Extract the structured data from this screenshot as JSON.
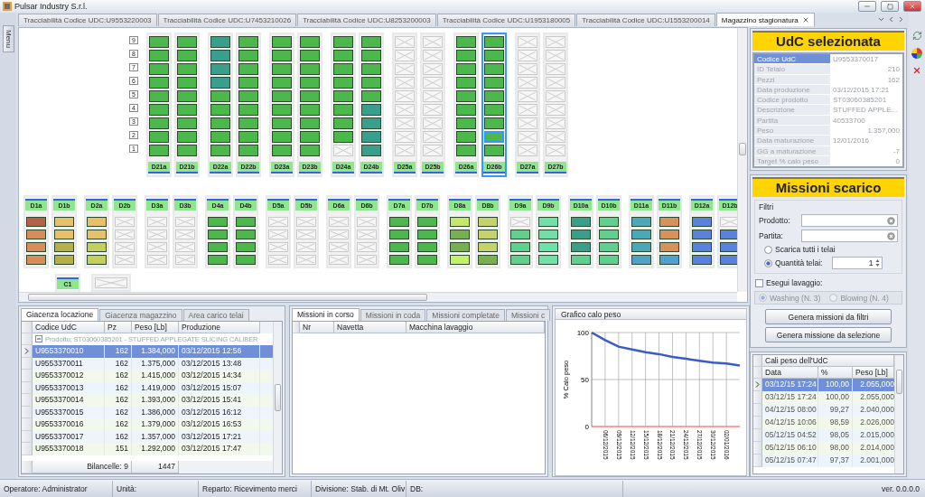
{
  "window": {
    "title": "Pulsar Industry S.r.l."
  },
  "menu_tab": {
    "label": "Menu"
  },
  "tabs": [
    {
      "label": "Tracciabilità Codice UDC:U9553220003",
      "selected": false
    },
    {
      "label": "Tracciabilità Codice UDC:U7453210026",
      "selected": false
    },
    {
      "label": "Tracciabilità Codice UDC:U8253200003",
      "selected": false
    },
    {
      "label": "Tracciabilità Codice UDC:U1953180005",
      "selected": false
    },
    {
      "label": "Tracciabilità Codice UDC:U1553200014",
      "selected": false
    },
    {
      "label": "Magazzino stagionatura",
      "selected": true
    }
  ],
  "warehouse": {
    "row_labels": [
      "9",
      "8",
      "7",
      "6",
      "5",
      "4",
      "3",
      "2",
      "1"
    ],
    "upper_columns": [
      {
        "label": "D21a",
        "selected": false,
        "slots": [
          {
            "kind": "filled",
            "color": "#4cb84c",
            "selected": false
          },
          {
            "kind": "filled",
            "color": "#4cb84c",
            "selected": false
          },
          {
            "kind": "filled",
            "color": "#4cb84c",
            "selected": false
          },
          {
            "kind": "filled",
            "color": "#4cb84c",
            "selected": false
          },
          {
            "kind": "filled",
            "color": "#4cb84c",
            "selected": false
          },
          {
            "kind": "filled",
            "color": "#4cb84c",
            "selected": false
          },
          {
            "kind": "filled",
            "color": "#4cb84c",
            "selected": false
          },
          {
            "kind": "filled",
            "color": "#4cb84c",
            "selected": false
          },
          {
            "kind": "filled",
            "color": "#4cb84c",
            "selected": false
          }
        ]
      },
      {
        "label": "D21b",
        "selected": false,
        "slots": [
          {
            "kind": "filled",
            "color": "#4cb84c",
            "selected": false
          },
          {
            "kind": "filled",
            "color": "#4cb84c",
            "selected": false
          },
          {
            "kind": "filled",
            "color": "#4cb84c",
            "selected": false
          },
          {
            "kind": "filled",
            "color": "#4cb84c",
            "selected": false
          },
          {
            "kind": "filled",
            "color": "#4cb84c",
            "selected": false
          },
          {
            "kind": "filled",
            "color": "#4cb84c",
            "selected": false
          },
          {
            "kind": "filled",
            "color": "#4cb84c",
            "selected": false
          },
          {
            "kind": "filled",
            "color": "#4cb84c",
            "selected": false
          },
          {
            "kind": "filled",
            "color": "#4cb84c",
            "selected": false
          }
        ]
      },
      {
        "label": "D22a",
        "selected": false,
        "slots": [
          {
            "kind": "filled",
            "color": "#3a9e8c",
            "selected": false
          },
          {
            "kind": "filled",
            "color": "#3a9e8c",
            "selected": false
          },
          {
            "kind": "filled",
            "color": "#3a9e8c",
            "selected": false
          },
          {
            "kind": "filled",
            "color": "#3a9e8c",
            "selected": false
          },
          {
            "kind": "filled",
            "color": "#4cb84c",
            "selected": false
          },
          {
            "kind": "filled",
            "color": "#4cb84c",
            "selected": false
          },
          {
            "kind": "filled",
            "color": "#4cb84c",
            "selected": false
          },
          {
            "kind": "filled",
            "color": "#4cb84c",
            "selected": false
          },
          {
            "kind": "filled",
            "color": "#4cb84c",
            "selected": false
          }
        ]
      },
      {
        "label": "D22b",
        "selected": false,
        "slots": [
          {
            "kind": "filled",
            "color": "#4cb84c",
            "selected": false
          },
          {
            "kind": "filled",
            "color": "#4cb84c",
            "selected": false
          },
          {
            "kind": "filled",
            "color": "#4cb84c",
            "selected": false
          },
          {
            "kind": "filled",
            "color": "#4cb84c",
            "selected": false
          },
          {
            "kind": "filled",
            "color": "#4cb84c",
            "selected": false
          },
          {
            "kind": "filled",
            "color": "#4cb84c",
            "selected": false
          },
          {
            "kind": "filled",
            "color": "#4cb84c",
            "selected": false
          },
          {
            "kind": "filled",
            "color": "#4cb84c",
            "selected": false
          },
          {
            "kind": "filled",
            "color": "#4cb84c",
            "selected": false
          }
        ]
      },
      {
        "label": "D23a",
        "selected": false,
        "slots": [
          {
            "kind": "filled",
            "color": "#4cb84c",
            "selected": false
          },
          {
            "kind": "filled",
            "color": "#4cb84c",
            "selected": false
          },
          {
            "kind": "filled",
            "color": "#4cb84c",
            "selected": false
          },
          {
            "kind": "filled",
            "color": "#4cb84c",
            "selected": false
          },
          {
            "kind": "filled",
            "color": "#4cb84c",
            "selected": false
          },
          {
            "kind": "filled",
            "color": "#4cb84c",
            "selected": false
          },
          {
            "kind": "filled",
            "color": "#4cb84c",
            "selected": false
          },
          {
            "kind": "filled",
            "color": "#4cb84c",
            "selected": false
          },
          {
            "kind": "filled",
            "color": "#4cb84c",
            "selected": false
          }
        ]
      },
      {
        "label": "D23b",
        "selected": false,
        "slots": [
          {
            "kind": "filled",
            "color": "#4cb84c",
            "selected": false
          },
          {
            "kind": "filled",
            "color": "#4cb84c",
            "selected": false
          },
          {
            "kind": "filled",
            "color": "#4cb84c",
            "selected": false
          },
          {
            "kind": "filled",
            "color": "#4cb84c",
            "selected": false
          },
          {
            "kind": "filled",
            "color": "#4cb84c",
            "selected": false
          },
          {
            "kind": "filled",
            "color": "#4cb84c",
            "selected": false
          },
          {
            "kind": "filled",
            "color": "#4cb84c",
            "selected": false
          },
          {
            "kind": "filled",
            "color": "#4cb84c",
            "selected": false
          },
          {
            "kind": "filled",
            "color": "#4cb84c",
            "selected": false
          }
        ]
      },
      {
        "label": "D24a",
        "selected": false,
        "slots": [
          {
            "kind": "filled",
            "color": "#4cb84c",
            "selected": false
          },
          {
            "kind": "filled",
            "color": "#4cb84c",
            "selected": false
          },
          {
            "kind": "filled",
            "color": "#4cb84c",
            "selected": false
          },
          {
            "kind": "filled",
            "color": "#4cb84c",
            "selected": false
          },
          {
            "kind": "filled",
            "color": "#4cb84c",
            "selected": false
          },
          {
            "kind": "filled",
            "color": "#4cb84c",
            "selected": false
          },
          {
            "kind": "filled",
            "color": "#4cb84c",
            "selected": false
          },
          {
            "kind": "filled",
            "color": "#4cb84c",
            "selected": false
          },
          {
            "kind": "empty",
            "selected": false
          }
        ]
      },
      {
        "label": "D24b",
        "selected": false,
        "slots": [
          {
            "kind": "filled",
            "color": "#4cb84c",
            "selected": false
          },
          {
            "kind": "filled",
            "color": "#4cb84c",
            "selected": false
          },
          {
            "kind": "filled",
            "color": "#4cb84c",
            "selected": false
          },
          {
            "kind": "filled",
            "color": "#4cb84c",
            "selected": false
          },
          {
            "kind": "filled",
            "color": "#4cb84c",
            "selected": false
          },
          {
            "kind": "filled",
            "color": "#3a9e8c",
            "selected": false
          },
          {
            "kind": "filled",
            "color": "#3a9e8c",
            "selected": false
          },
          {
            "kind": "filled",
            "color": "#3a9e8c",
            "selected": false
          },
          {
            "kind": "filled",
            "color": "#3a9e8c",
            "selected": false
          }
        ]
      },
      {
        "label": "D25a",
        "selected": false,
        "slots": [
          {
            "kind": "empty",
            "selected": false
          },
          {
            "kind": "empty",
            "selected": false
          },
          {
            "kind": "empty",
            "selected": false
          },
          {
            "kind": "empty",
            "selected": false
          },
          {
            "kind": "empty",
            "selected": false
          },
          {
            "kind": "empty",
            "selected": false
          },
          {
            "kind": "empty",
            "selected": false
          },
          {
            "kind": "empty",
            "selected": false
          },
          {
            "kind": "empty",
            "selected": false
          }
        ]
      },
      {
        "label": "D25b",
        "selected": false,
        "slots": [
          {
            "kind": "empty",
            "selected": false
          },
          {
            "kind": "empty",
            "selected": false
          },
          {
            "kind": "empty",
            "selected": false
          },
          {
            "kind": "empty",
            "selected": false
          },
          {
            "kind": "empty",
            "selected": false
          },
          {
            "kind": "empty",
            "selected": false
          },
          {
            "kind": "empty",
            "selected": false
          },
          {
            "kind": "empty",
            "selected": false
          },
          {
            "kind": "empty",
            "selected": false
          }
        ]
      },
      {
        "label": "D26a",
        "selected": false,
        "slots": [
          {
            "kind": "filled",
            "color": "#4cb84c",
            "selected": false
          },
          {
            "kind": "filled",
            "color": "#4cb84c",
            "selected": false
          },
          {
            "kind": "filled",
            "color": "#4cb84c",
            "selected": false
          },
          {
            "kind": "filled",
            "color": "#4cb84c",
            "selected": false
          },
          {
            "kind": "filled",
            "color": "#4cb84c",
            "selected": false
          },
          {
            "kind": "filled",
            "color": "#4cb84c",
            "selected": false
          },
          {
            "kind": "filled",
            "color": "#4cb84c",
            "selected": false
          },
          {
            "kind": "filled",
            "color": "#4cb84c",
            "selected": false
          },
          {
            "kind": "filled",
            "color": "#4cb84c",
            "selected": false
          }
        ]
      },
      {
        "label": "D26b",
        "selected": true,
        "slots": [
          {
            "kind": "filled",
            "color": "#4cb84c",
            "selected": false
          },
          {
            "kind": "filled",
            "color": "#4cb84c",
            "selected": false
          },
          {
            "kind": "filled",
            "color": "#4cb84c",
            "selected": false
          },
          {
            "kind": "filled",
            "color": "#4cb84c",
            "selected": false
          },
          {
            "kind": "filled",
            "color": "#4cb84c",
            "selected": false
          },
          {
            "kind": "filled",
            "color": "#4cb84c",
            "selected": false
          },
          {
            "kind": "filled",
            "color": "#4cb84c",
            "selected": false
          },
          {
            "kind": "filled",
            "color": "#4cb84c",
            "selected": true
          },
          {
            "kind": "filled",
            "color": "#4cb84c",
            "selected": false
          }
        ]
      },
      {
        "label": "D27a",
        "selected": false,
        "slots": [
          {
            "kind": "empty",
            "selected": false
          },
          {
            "kind": "empty",
            "selected": false
          },
          {
            "kind": "empty",
            "selected": false
          },
          {
            "kind": "empty",
            "selected": false
          },
          {
            "kind": "empty",
            "selected": false
          },
          {
            "kind": "empty",
            "selected": false
          },
          {
            "kind": "empty",
            "selected": false
          },
          {
            "kind": "empty",
            "selected": false
          },
          {
            "kind": "empty",
            "selected": false
          }
        ]
      },
      {
        "label": "D27b",
        "selected": false,
        "slots": [
          {
            "kind": "empty",
            "selected": false
          },
          {
            "kind": "empty",
            "selected": false
          },
          {
            "kind": "empty",
            "selected": false
          },
          {
            "kind": "empty",
            "selected": false
          },
          {
            "kind": "empty",
            "selected": false
          },
          {
            "kind": "empty",
            "selected": false
          },
          {
            "kind": "empty",
            "selected": false
          },
          {
            "kind": "empty",
            "selected": false
          },
          {
            "kind": "empty",
            "selected": false
          }
        ]
      }
    ],
    "lower_columns": [
      {
        "label": "D1a",
        "slots": [
          {
            "kind": "filled",
            "color": "#b5614a"
          },
          {
            "kind": "filled",
            "color": "#d98b5a"
          },
          {
            "kind": "filled",
            "color": "#d98b5a"
          },
          {
            "kind": "filled",
            "color": "#d98b5a"
          }
        ]
      },
      {
        "label": "D1b",
        "slots": [
          {
            "kind": "filled",
            "color": "#e8c06a"
          },
          {
            "kind": "filled",
            "color": "#e8c06a"
          },
          {
            "kind": "filled",
            "color": "#b8ae4a"
          },
          {
            "kind": "filled",
            "color": "#b8ae4a"
          }
        ]
      },
      {
        "label": "D2a",
        "slots": [
          {
            "kind": "filled",
            "color": "#e8c06a"
          },
          {
            "kind": "filled",
            "color": "#e8c06a"
          },
          {
            "kind": "filled",
            "color": "#c4cf5e"
          },
          {
            "kind": "filled",
            "color": "#c4cf5e"
          }
        ]
      },
      {
        "label": "D2b",
        "slots": [
          {
            "kind": "empty"
          },
          {
            "kind": "empty"
          },
          {
            "kind": "empty"
          },
          {
            "kind": "empty"
          }
        ]
      },
      {
        "label": "D3a",
        "slots": [
          {
            "kind": "empty"
          },
          {
            "kind": "empty"
          },
          {
            "kind": "empty"
          },
          {
            "kind": "empty"
          }
        ]
      },
      {
        "label": "D3b",
        "slots": [
          {
            "kind": "empty"
          },
          {
            "kind": "empty"
          },
          {
            "kind": "empty"
          },
          {
            "kind": "empty"
          }
        ]
      },
      {
        "label": "D4a",
        "slots": [
          {
            "kind": "filled",
            "color": "#4cb84c"
          },
          {
            "kind": "filled",
            "color": "#4cb84c"
          },
          {
            "kind": "filled",
            "color": "#4cb84c"
          },
          {
            "kind": "filled",
            "color": "#4cb84c"
          }
        ]
      },
      {
        "label": "D4b",
        "slots": [
          {
            "kind": "filled",
            "color": "#4cb84c"
          },
          {
            "kind": "filled",
            "color": "#4cb84c"
          },
          {
            "kind": "filled",
            "color": "#4cb84c"
          },
          {
            "kind": "filled",
            "color": "#4cb84c"
          }
        ]
      },
      {
        "label": "D5a",
        "slots": [
          {
            "kind": "empty"
          },
          {
            "kind": "empty"
          },
          {
            "kind": "empty"
          },
          {
            "kind": "empty"
          }
        ]
      },
      {
        "label": "D5b",
        "slots": [
          {
            "kind": "empty"
          },
          {
            "kind": "empty"
          },
          {
            "kind": "empty"
          },
          {
            "kind": "empty"
          }
        ]
      },
      {
        "label": "D6a",
        "slots": [
          {
            "kind": "empty"
          },
          {
            "kind": "empty"
          },
          {
            "kind": "empty"
          },
          {
            "kind": "empty"
          }
        ]
      },
      {
        "label": "D6b",
        "slots": [
          {
            "kind": "empty"
          },
          {
            "kind": "empty"
          },
          {
            "kind": "empty"
          },
          {
            "kind": "empty"
          }
        ]
      },
      {
        "label": "D7a",
        "slots": [
          {
            "kind": "filled",
            "color": "#4cb84c"
          },
          {
            "kind": "filled",
            "color": "#4cb84c"
          },
          {
            "kind": "filled",
            "color": "#4cb84c"
          },
          {
            "kind": "filled",
            "color": "#4cb84c"
          }
        ]
      },
      {
        "label": "D7b",
        "slots": [
          {
            "kind": "filled",
            "color": "#4cb84c"
          },
          {
            "kind": "filled",
            "color": "#4cb84c"
          },
          {
            "kind": "filled",
            "color": "#4cb84c"
          },
          {
            "kind": "filled",
            "color": "#4cb84c"
          }
        ]
      },
      {
        "label": "D8a",
        "slots": [
          {
            "kind": "filled",
            "color": "#c5e86a"
          },
          {
            "kind": "filled",
            "color": "#78b050"
          },
          {
            "kind": "filled",
            "color": "#78b050"
          },
          {
            "kind": "filled",
            "color": "#c5f06a"
          }
        ]
      },
      {
        "label": "D8b",
        "slots": [
          {
            "kind": "filled",
            "color": "#c8d26a"
          },
          {
            "kind": "filled",
            "color": "#c8d26a"
          },
          {
            "kind": "filled",
            "color": "#c8d26a"
          },
          {
            "kind": "filled",
            "color": "#78b050"
          }
        ]
      },
      {
        "label": "D9a",
        "slots": [
          {
            "kind": "empty"
          },
          {
            "kind": "filled",
            "color": "#5fd090"
          },
          {
            "kind": "filled",
            "color": "#5fd090"
          },
          {
            "kind": "filled",
            "color": "#5fd090"
          }
        ]
      },
      {
        "label": "D9b",
        "slots": [
          {
            "kind": "filled",
            "color": "#6ee0a8"
          },
          {
            "kind": "filled",
            "color": "#6ee0a8"
          },
          {
            "kind": "filled",
            "color": "#6ee0a8"
          },
          {
            "kind": "filled",
            "color": "#6ee0a8"
          }
        ]
      },
      {
        "label": "D10a",
        "slots": [
          {
            "kind": "filled",
            "color": "#3a9e8c"
          },
          {
            "kind": "filled",
            "color": "#3a9e8c"
          },
          {
            "kind": "filled",
            "color": "#3a9e8c"
          },
          {
            "kind": "filled",
            "color": "#5fd090"
          }
        ]
      },
      {
        "label": "D10b",
        "slots": [
          {
            "kind": "filled",
            "color": "#5fd090"
          },
          {
            "kind": "filled",
            "color": "#5fd090"
          },
          {
            "kind": "filled",
            "color": "#5fd090"
          },
          {
            "kind": "filled",
            "color": "#5fd090"
          }
        ]
      },
      {
        "label": "D11a",
        "slots": [
          {
            "kind": "filled",
            "color": "#4aa8b8"
          },
          {
            "kind": "filled",
            "color": "#4aa8b8"
          },
          {
            "kind": "filled",
            "color": "#4aa8b8"
          },
          {
            "kind": "filled",
            "color": "#50a0c8"
          }
        ]
      },
      {
        "label": "D11b",
        "slots": [
          {
            "kind": "filled",
            "color": "#d9905a"
          },
          {
            "kind": "filled",
            "color": "#d9905a"
          },
          {
            "kind": "filled",
            "color": "#d9905a"
          },
          {
            "kind": "filled",
            "color": "#50a0d0"
          }
        ]
      },
      {
        "label": "D12a",
        "slots": [
          {
            "kind": "filled",
            "color": "#5a80e0"
          },
          {
            "kind": "filled",
            "color": "#5a80e0"
          },
          {
            "kind": "filled",
            "color": "#5a80e0"
          },
          {
            "kind": "filled",
            "color": "#5a80e0"
          }
        ]
      },
      {
        "label": "D12b",
        "slots": [
          {
            "kind": "empty"
          },
          {
            "kind": "filled",
            "color": "#5a80e0"
          },
          {
            "kind": "filled",
            "color": "#5a80e0"
          },
          {
            "kind": "filled",
            "color": "#5a80e0"
          }
        ]
      }
    ],
    "c_bay": {
      "label": "C1",
      "slots": [
        {
          "kind": "empty"
        }
      ]
    }
  },
  "stock_panel": {
    "tabs": [
      {
        "label": "Giacenza locazione",
        "selected": true
      },
      {
        "label": "Giacenza magazzino",
        "selected": false
      },
      {
        "label": "Area carico telai",
        "selected": false
      }
    ],
    "columns": [
      "Codice UdC",
      "Pz",
      "Peso [Lb]",
      "Produzione"
    ],
    "group_label": "Prodotto: ST03060385201  - STUFFED APPLEGATE SLICING CALIBER",
    "rows": [
      {
        "code": "U9553370010",
        "pz": "162",
        "peso": "1.384,000",
        "produzione": "03/12/2015 12:56",
        "selected": true
      },
      {
        "code": "U9553370011",
        "pz": "162",
        "peso": "1.375,000",
        "produzione": "03/12/2015 13:48",
        "selected": false
      },
      {
        "code": "U9553370012",
        "pz": "162",
        "peso": "1.415,000",
        "produzione": "03/12/2015 14:34",
        "selected": false
      },
      {
        "code": "U9553370013",
        "pz": "162",
        "peso": "1.419,000",
        "produzione": "03/12/2015 15:07",
        "selected": false
      },
      {
        "code": "U9553370014",
        "pz": "162",
        "peso": "1.393,000",
        "produzione": "03/12/2015 15:41",
        "selected": false
      },
      {
        "code": "U9553370015",
        "pz": "162",
        "peso": "1.386,000",
        "produzione": "03/12/2015 16:12",
        "selected": false
      },
      {
        "code": "U9553370016",
        "pz": "162",
        "peso": "1.379,000",
        "produzione": "03/12/2015 16:53",
        "selected": false
      },
      {
        "code": "U9553370017",
        "pz": "162",
        "peso": "1.357,000",
        "produzione": "03/12/2015 17:21",
        "selected": false
      },
      {
        "code": "U9553370018",
        "pz": "151",
        "peso": "1.292,000",
        "produzione": "03/12/2015 17:47",
        "selected": false
      }
    ],
    "footer": {
      "count": "Bilancelle: 9",
      "total": "1447"
    }
  },
  "missions_panel": {
    "tabs": [
      {
        "label": "Missioni in corso",
        "selected": true
      },
      {
        "label": "Missioni in coda",
        "selected": false
      },
      {
        "label": "Missioni completate",
        "selected": false
      },
      {
        "label": "Missioni c",
        "selected": false
      }
    ],
    "columns": [
      "Nr",
      "Navetta",
      "Macchina lavaggio"
    ]
  },
  "chart_panel": {
    "title": "Grafico calo peso",
    "chart_data": {
      "type": "line",
      "ylabel": "% Calo peso",
      "categories": [
        null,
        "06/12/2015",
        "09/12/2015",
        "12/12/2015",
        "15/12/2015",
        "18/12/2015",
        "21/12/2015",
        "24/12/2015",
        "27/12/2015",
        "30/12/2015",
        "02/01/2016",
        null
      ],
      "series": [
        {
          "color": "#3a5cc8",
          "values": [
            100,
            92,
            85,
            82,
            79,
            77,
            74,
            72,
            70,
            68,
            67,
            65
          ]
        }
      ],
      "ylim": [
        0,
        100
      ],
      "yticks": [
        0,
        50,
        100
      ],
      "grid": true
    }
  },
  "selected_udc": {
    "title": "UdC selezionata",
    "properties": [
      {
        "label": "Codice UdC",
        "value": "U9553370017",
        "kind": "text",
        "selected": true
      },
      {
        "label": "ID Telaio",
        "value": "210",
        "kind": "number",
        "selected": false
      },
      {
        "label": "Pezzi",
        "value": "162",
        "kind": "number",
        "selected": false
      },
      {
        "label": "Data produzione",
        "value": "03/12/2015 17:21",
        "kind": "text",
        "selected": false
      },
      {
        "label": "Codice prodotto",
        "value": "ST03060385201",
        "kind": "text",
        "selected": false
      },
      {
        "label": "Descrizione",
        "value": "STUFFED APPLE...",
        "kind": "text",
        "selected": false
      },
      {
        "label": "Partita",
        "value": "40533700",
        "kind": "text",
        "selected": false
      },
      {
        "label": "Peso",
        "value": "1.357,000",
        "kind": "number",
        "selected": false
      },
      {
        "label": "Data maturazione",
        "value": "12/01/2016",
        "kind": "text",
        "selected": false
      },
      {
        "label": "GG a maturazione",
        "value": "-7",
        "kind": "number",
        "selected": false
      },
      {
        "label": "Target % calo peso",
        "value": "0",
        "kind": "number",
        "selected": false
      }
    ]
  },
  "unload_missions": {
    "title": "Missioni scarico",
    "filters_label": "Filtri",
    "fields": [
      {
        "label": "Prodotto:"
      },
      {
        "label": "Partita:"
      }
    ],
    "modes": [
      {
        "label": "Scarica tutti i telai",
        "selected": false
      },
      {
        "label": "Quantità telai:",
        "selected": true
      }
    ],
    "quantity": "1",
    "washing": {
      "label": "Esegui lavaggio:",
      "checked": false,
      "disabled": true,
      "options": [
        {
          "label": "Washing (N. 3)",
          "selected": true
        },
        {
          "label": "Blowing (N. 4)",
          "selected": false
        }
      ]
    },
    "buttons": [
      "Genera missioni da filtri",
      "Genera missione da selezione"
    ]
  },
  "weight_loss": {
    "title": "Cali peso dell'UdC",
    "columns": [
      "Data",
      "%",
      "Peso [Lb]"
    ],
    "rows": [
      {
        "date": "03/12/15 17:24",
        "percent": "100,00",
        "peso": "2.055,000",
        "selected": true
      },
      {
        "date": "03/12/15 17:24",
        "percent": "100,00",
        "peso": "2.055,000",
        "selected": false
      },
      {
        "date": "04/12/15 08:00",
        "percent": "99,27",
        "peso": "2.040,000",
        "selected": false
      },
      {
        "date": "04/12/15 10:06",
        "percent": "98,59",
        "peso": "2.026,000",
        "selected": false
      },
      {
        "date": "05/12/15 04:52",
        "percent": "98,05",
        "peso": "2.015,000",
        "selected": false
      },
      {
        "date": "05/12/15 06:10",
        "percent": "98,00",
        "peso": "2.014,000",
        "selected": false
      },
      {
        "date": "05/12/15 07:47",
        "percent": "97,37",
        "peso": "2.001,000",
        "selected": false
      }
    ]
  },
  "status_bar": {
    "items": [
      "Operatore: Administrator",
      "Unità:",
      "Reparto: Ricevimento merci",
      "Divisione: Stab. di Mt. Oliv",
      "DB:"
    ],
    "version": "ver. 0.0.0.0"
  }
}
